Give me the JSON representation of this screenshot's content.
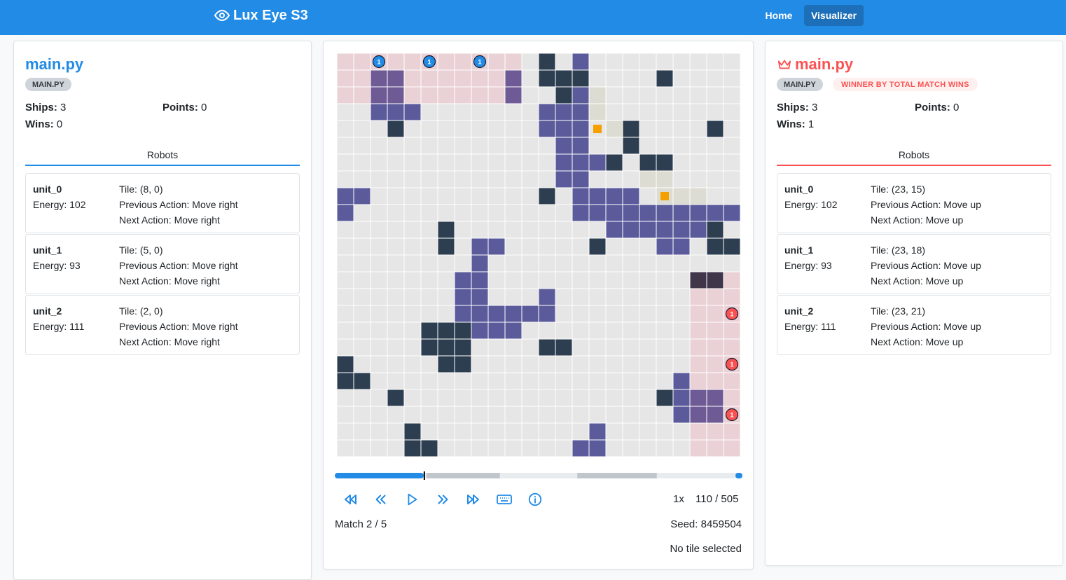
{
  "header": {
    "brand": "Lux Eye S3",
    "nav": {
      "home": "Home",
      "visualizer": "Visualizer"
    },
    "brand_color": "#228be6"
  },
  "left_player": {
    "name": "main.py",
    "badge": "MAIN.PY",
    "ships_label": "Ships:",
    "ships": "3",
    "points_label": "Points:",
    "points": "0",
    "wins_label": "Wins:",
    "wins": "0",
    "tab": "Robots",
    "color": "#228be6",
    "robots": [
      {
        "name": "unit_0",
        "energy": "Energy: 102",
        "tile": "Tile: (8, 0)",
        "prev": "Previous Action: Move right",
        "next": "Next Action: Move right"
      },
      {
        "name": "unit_1",
        "energy": "Energy: 93",
        "tile": "Tile: (5, 0)",
        "prev": "Previous Action: Move right",
        "next": "Next Action: Move right"
      },
      {
        "name": "unit_2",
        "energy": "Energy: 111",
        "tile": "Tile: (2, 0)",
        "prev": "Previous Action: Move right",
        "next": "Next Action: Move right"
      }
    ]
  },
  "right_player": {
    "name": "main.py",
    "badge": "MAIN.PY",
    "winner_badge": "WINNER BY TOTAL MATCH WINS",
    "ships_label": "Ships:",
    "ships": "3",
    "points_label": "Points:",
    "points": "0",
    "wins_label": "Wins:",
    "wins": "1",
    "tab": "Robots",
    "color": "#fa5252",
    "robots": [
      {
        "name": "unit_0",
        "energy": "Energy: 102",
        "tile": "Tile: (23, 15)",
        "prev": "Previous Action: Move up",
        "next": "Next Action: Move up"
      },
      {
        "name": "unit_1",
        "energy": "Energy: 93",
        "tile": "Tile: (23, 18)",
        "prev": "Previous Action: Move up",
        "next": "Next Action: Move up"
      },
      {
        "name": "unit_2",
        "energy": "Energy: 111",
        "tile": "Tile: (23, 21)",
        "prev": "Previous Action: Move up",
        "next": "Next Action: Move up"
      }
    ]
  },
  "board": {
    "size": 24,
    "colors": {
      "empty": "#e6e6e6",
      "asteroid": "#2c3e50",
      "nebula": "#5b5b9c",
      "relic_area": "#dcdcd2",
      "relic": "#f59f00",
      "left_vision": "#ead1d6",
      "right_vision": "#ead1d6",
      "left_unit": "#228be6",
      "right_unit": "#fa5252"
    },
    "asteroids": [
      [
        12,
        0
      ],
      [
        12,
        1
      ],
      [
        13,
        1
      ],
      [
        14,
        1
      ],
      [
        19,
        1
      ],
      [
        13,
        2
      ],
      [
        3,
        4
      ],
      [
        17,
        4
      ],
      [
        22,
        4
      ],
      [
        17,
        5
      ],
      [
        16,
        6
      ],
      [
        18,
        6
      ],
      [
        19,
        6
      ],
      [
        12,
        8
      ],
      [
        6,
        10
      ],
      [
        6,
        11
      ],
      [
        15,
        11
      ],
      [
        22,
        10
      ],
      [
        22,
        11
      ],
      [
        23,
        11
      ],
      [
        21,
        13
      ],
      [
        22,
        13
      ],
      [
        5,
        16
      ],
      [
        6,
        16
      ],
      [
        7,
        16
      ],
      [
        5,
        17
      ],
      [
        6,
        17
      ],
      [
        7,
        17
      ],
      [
        12,
        17
      ],
      [
        13,
        17
      ],
      [
        6,
        18
      ],
      [
        7,
        18
      ],
      [
        0,
        18
      ],
      [
        0,
        19
      ],
      [
        1,
        19
      ],
      [
        3,
        20
      ],
      [
        19,
        20
      ],
      [
        4,
        22
      ],
      [
        4,
        23
      ],
      [
        5,
        23
      ]
    ],
    "nebula": [
      [
        14,
        0
      ],
      [
        2,
        1
      ],
      [
        3,
        1
      ],
      [
        10,
        1
      ],
      [
        2,
        2
      ],
      [
        3,
        2
      ],
      [
        10,
        2
      ],
      [
        13,
        2
      ],
      [
        14,
        2
      ],
      [
        2,
        3
      ],
      [
        3,
        3
      ],
      [
        4,
        3
      ],
      [
        12,
        3
      ],
      [
        13,
        3
      ],
      [
        14,
        3
      ],
      [
        12,
        4
      ],
      [
        13,
        4
      ],
      [
        14,
        4
      ],
      [
        13,
        5
      ],
      [
        14,
        5
      ],
      [
        13,
        6
      ],
      [
        14,
        6
      ],
      [
        15,
        6
      ],
      [
        13,
        7
      ],
      [
        14,
        7
      ],
      [
        0,
        8
      ],
      [
        1,
        8
      ],
      [
        14,
        8
      ],
      [
        15,
        8
      ],
      [
        16,
        8
      ],
      [
        17,
        8
      ],
      [
        0,
        9
      ],
      [
        14,
        9
      ],
      [
        15,
        9
      ],
      [
        16,
        9
      ],
      [
        17,
        9
      ],
      [
        18,
        9
      ],
      [
        19,
        9
      ],
      [
        20,
        9
      ],
      [
        21,
        9
      ],
      [
        22,
        9
      ],
      [
        23,
        9
      ],
      [
        16,
        10
      ],
      [
        17,
        10
      ],
      [
        18,
        10
      ],
      [
        19,
        10
      ],
      [
        20,
        10
      ],
      [
        21,
        10
      ],
      [
        8,
        11
      ],
      [
        9,
        11
      ],
      [
        19,
        11
      ],
      [
        20,
        11
      ],
      [
        8,
        12
      ],
      [
        7,
        13
      ],
      [
        8,
        13
      ],
      [
        7,
        14
      ],
      [
        8,
        14
      ],
      [
        12,
        14
      ],
      [
        7,
        15
      ],
      [
        8,
        15
      ],
      [
        9,
        15
      ],
      [
        10,
        15
      ],
      [
        11,
        15
      ],
      [
        12,
        15
      ],
      [
        8,
        16
      ],
      [
        9,
        16
      ],
      [
        10,
        16
      ],
      [
        20,
        19
      ],
      [
        20,
        20
      ],
      [
        21,
        20
      ],
      [
        22,
        20
      ],
      [
        20,
        21
      ],
      [
        21,
        21
      ],
      [
        22,
        21
      ],
      [
        15,
        22
      ],
      [
        14,
        23
      ],
      [
        15,
        23
      ]
    ],
    "relic_areas": [
      [
        15,
        2
      ],
      [
        15,
        3
      ],
      [
        16,
        4
      ],
      [
        18,
        7
      ],
      [
        19,
        7
      ],
      [
        19,
        8
      ],
      [
        20,
        8
      ],
      [
        21,
        8
      ]
    ],
    "relics": [
      [
        15,
        4
      ],
      [
        19,
        8
      ]
    ],
    "left_vision_rect": [
      0,
      0,
      10,
      2
    ],
    "right_vision_rect": [
      21,
      13,
      23,
      23
    ],
    "left_units": [
      [
        2,
        0,
        "1"
      ],
      [
        5,
        0,
        "1"
      ],
      [
        8,
        0,
        "1"
      ]
    ],
    "right_units": [
      [
        23,
        15,
        "1"
      ],
      [
        23,
        18,
        "1"
      ],
      [
        23,
        21,
        "1"
      ]
    ]
  },
  "timeline": {
    "progress": 0.218,
    "segments": [
      [
        0.225,
        0.405
      ],
      [
        0.595,
        0.79
      ]
    ],
    "played_color": "#228be6"
  },
  "playback": {
    "speed": "1x",
    "turn": "110 / 505",
    "match": "Match 2 / 5",
    "seed": "Seed: 8459504",
    "tile_status": "No tile selected"
  },
  "icons": [
    "eye-icon",
    "crown-icon",
    "skip-back-icon",
    "step-back-icon",
    "play-icon",
    "step-forward-icon",
    "skip-forward-icon",
    "keyboard-icon",
    "info-icon"
  ]
}
